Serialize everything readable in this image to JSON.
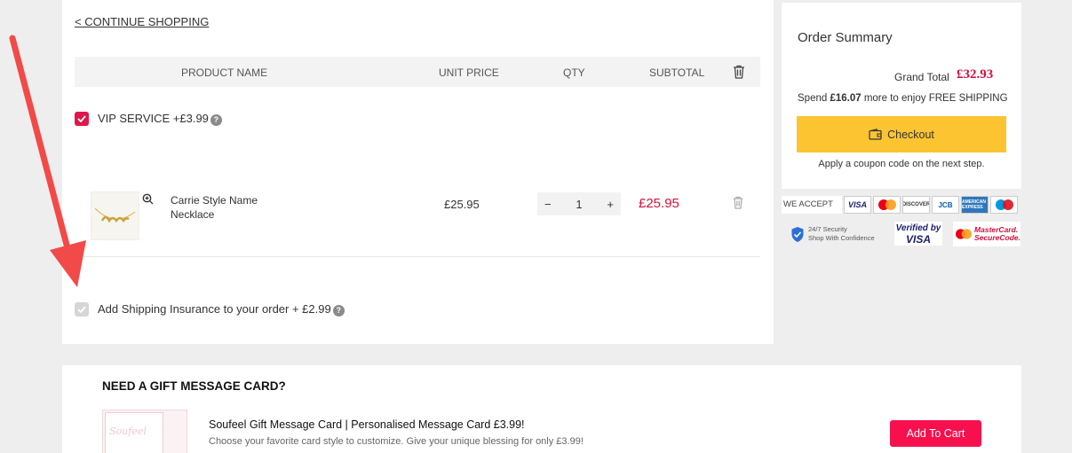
{
  "cart": {
    "continue_label": "< CONTINUE SHOPPING",
    "columns": {
      "product_name": "PRODUCT NAME",
      "unit_price": "UNIT PRICE",
      "qty": "QTY",
      "subtotal": "SUBTOTAL"
    },
    "vip_service": {
      "label": "VIP SERVICE +£3.99",
      "checked": true,
      "help": "?"
    },
    "items": [
      {
        "name": "Carrie Style Name Necklace",
        "unit_price": "£25.95",
        "qty": "1",
        "minus": "−",
        "plus": "+",
        "subtotal": "£25.95"
      }
    ],
    "shipping_insurance": {
      "label": "Add Shipping Insurance to your order + £2.99",
      "checked": true,
      "help": "?"
    }
  },
  "summary": {
    "title": "Order Summary",
    "grand_total_label": "Grand Total",
    "grand_total_value": "£32.93",
    "spend_prefix": "Spend ",
    "spend_amount": "£16.07",
    "spend_suffix": " more to enjoy FREE SHIPPING",
    "checkout_label": "Checkout",
    "coupon_note": "Apply a coupon code on the next step."
  },
  "payment": {
    "we_accept": "WE ACCEPT",
    "cards": [
      "VISA",
      "MasterCard",
      "DISCOVER",
      "JCB",
      "AMERICAN EXPRESS",
      "Maestro"
    ],
    "security_line1": "24/7 Security",
    "security_line2": "Shop With Confidence",
    "verified_line1": "Verified by",
    "verified_line2": "VISA",
    "mc_line1": "MasterCard.",
    "mc_line2": "SecureCode."
  },
  "gift": {
    "title": "NEED A GIFT MESSAGE CARD?",
    "thumb_text": "Soufeel",
    "name": "Soufeel Gift Message Card | Personalised Message Card £3.99!",
    "description": "Choose your favorite card style to customize. Give your unique blessing for only £3.99!",
    "add_to_cart_label": "Add To Cart"
  },
  "colors": {
    "accent_red": "#d4103f",
    "checkout_yellow": "#fdc432",
    "add_to_cart_red": "#f8104e",
    "annotation_arrow": "#f24a48"
  }
}
